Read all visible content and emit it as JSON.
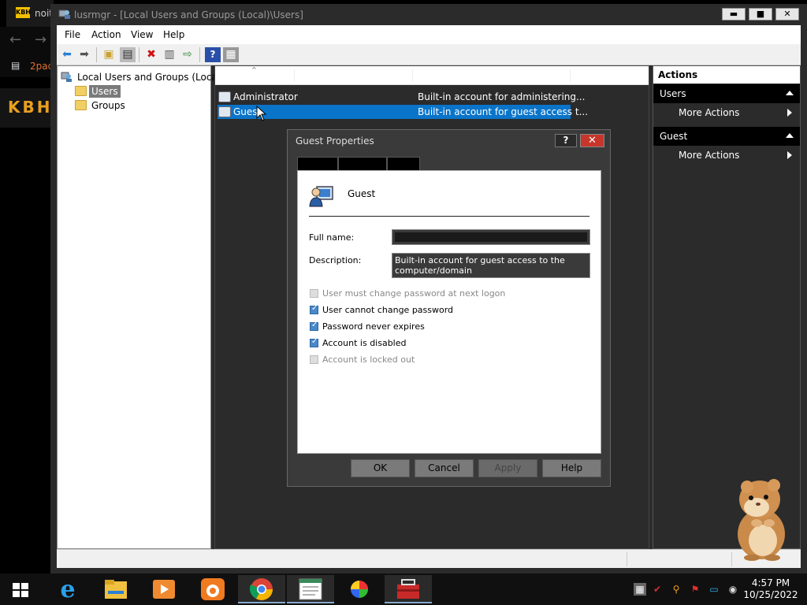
{
  "background_browser": {
    "tab_favicon": "KBH",
    "tab_title": "noit",
    "bookmark": "2pac",
    "logo": "KBH"
  },
  "window": {
    "title": "lusrmgr - [Local Users and Groups (Local)\\Users]",
    "minimize": "▬",
    "maximize": "■",
    "close": "✕"
  },
  "menubar": {
    "file": "File",
    "action": "Action",
    "view": "View",
    "help": "Help"
  },
  "toolbar": {
    "icons": [
      "back-arrow-icon",
      "forward-arrow-icon",
      "up-folder-icon",
      "show-tree-icon",
      "delete-icon",
      "properties-icon",
      "export-icon",
      "help-icon",
      "show-action-pane-icon"
    ]
  },
  "tree": {
    "root": "Local Users and Groups (Local)",
    "items": [
      {
        "label": "Users",
        "selected": true
      },
      {
        "label": "Groups",
        "selected": false
      }
    ]
  },
  "list": {
    "sort_indicator": "^",
    "rows": [
      {
        "name": "Administrator",
        "description": "Built-in account for administering...",
        "selected": false
      },
      {
        "name": "Guest",
        "description": "Built-in account for guest access t...",
        "selected": true
      }
    ]
  },
  "actions": {
    "title": "Actions",
    "sections": [
      {
        "header": "Users",
        "item": "More Actions"
      },
      {
        "header": "Guest",
        "item": "More Actions"
      }
    ]
  },
  "dialog": {
    "title": "Guest Properties",
    "help": "?",
    "close": "✕",
    "user_name": "Guest",
    "full_name_label": "Full name:",
    "full_name_value": "",
    "description_label": "Description:",
    "description_value": "Built-in account for guest access to the computer/domain",
    "checkboxes": [
      {
        "label": "User must change password at next logon",
        "checked": false,
        "disabled": true
      },
      {
        "label": "User cannot change password",
        "checked": true,
        "disabled": false
      },
      {
        "label": "Password never expires",
        "checked": true,
        "disabled": false
      },
      {
        "label": "Account is disabled",
        "checked": true,
        "disabled": false
      },
      {
        "label": "Account is locked out",
        "checked": false,
        "disabled": true
      }
    ],
    "buttons": {
      "ok": "OK",
      "cancel": "Cancel",
      "apply": "Apply",
      "help": "Help"
    }
  },
  "taskbar": {
    "apps": [
      "internet-explorer-icon",
      "file-explorer-icon",
      "media-player-icon",
      "uc-browser-icon",
      "chrome-icon",
      "notepad-icon",
      "colorful-app-icon",
      "toolbox-app-icon"
    ],
    "clock_time": "4:57 PM",
    "clock_date": "10/25/2022"
  },
  "colors": {
    "selection": "#0a74c9",
    "dark_bg": "#2b2b2b",
    "close_red": "#c8352b"
  }
}
